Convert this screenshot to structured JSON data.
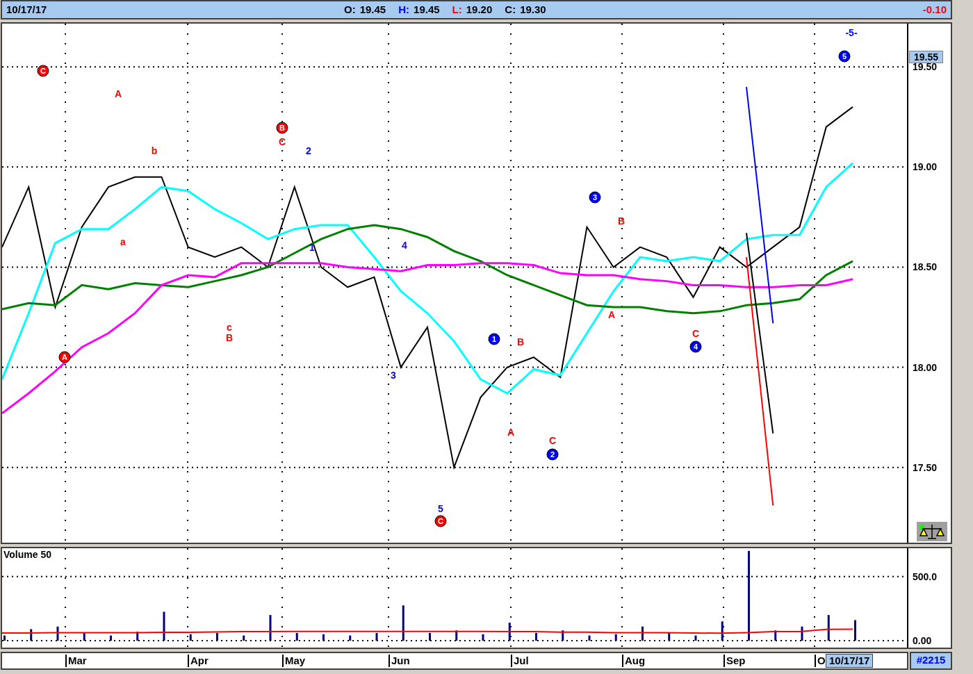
{
  "header": {
    "date": "10/17/17",
    "fields": [
      {
        "label": "O:",
        "value": "19.45"
      },
      {
        "label": "H:",
        "value": "19.45"
      },
      {
        "label": "L:",
        "value": "19.20"
      },
      {
        "label": "C:",
        "value": "19.30"
      }
    ],
    "change": "-0.10"
  },
  "price_pane": {
    "last_price": "19.55",
    "chart_data": {
      "type": "line",
      "categories": [
        null,
        null,
        null,
        null,
        null,
        null,
        null,
        null,
        null,
        null,
        null,
        null,
        null,
        null,
        null,
        null,
        null,
        null,
        null,
        null,
        null,
        null,
        null,
        null,
        null,
        null,
        null,
        null,
        null,
        null,
        null,
        null,
        null
      ],
      "series": [
        {
          "color": "#000000",
          "values": [
            18.6,
            18.9,
            18.3,
            18.7,
            18.9,
            18.95,
            18.95,
            18.6,
            18.55,
            18.6,
            18.5,
            18.9,
            18.5,
            18.4,
            18.45,
            18.0,
            18.2,
            17.5,
            17.85,
            18.0,
            18.05,
            17.95,
            18.7,
            18.5,
            18.6,
            18.55,
            18.35,
            18.6,
            18.5,
            18.6,
            18.7,
            19.2,
            19.3
          ]
        },
        {
          "color": "#00ffff",
          "values": [
            17.94,
            18.27,
            18.62,
            18.69,
            18.69,
            18.79,
            18.9,
            18.88,
            18.79,
            18.72,
            18.64,
            18.69,
            18.71,
            18.71,
            18.55,
            18.38,
            18.27,
            18.13,
            17.94,
            17.87,
            17.99,
            17.96,
            18.17,
            18.38,
            18.55,
            18.53,
            18.55,
            18.53,
            18.64,
            18.66,
            18.66,
            18.9,
            19.02
          ]
        },
        {
          "color": "#008000",
          "values": [
            18.29,
            18.32,
            18.31,
            18.41,
            18.39,
            18.42,
            18.41,
            18.4,
            18.43,
            18.46,
            18.5,
            18.57,
            18.64,
            18.69,
            18.71,
            18.69,
            18.65,
            18.58,
            18.53,
            18.46,
            18.41,
            18.36,
            18.31,
            18.3,
            18.3,
            18.28,
            18.27,
            18.28,
            18.31,
            18.32,
            18.34,
            18.46,
            18.53
          ]
        },
        {
          "color": "#ff00ff",
          "values": [
            17.77,
            17.87,
            17.98,
            18.1,
            18.17,
            18.27,
            18.41,
            18.46,
            18.45,
            18.52,
            18.52,
            18.52,
            18.52,
            18.5,
            18.49,
            18.48,
            18.51,
            18.51,
            18.52,
            18.52,
            18.51,
            18.47,
            18.46,
            18.46,
            18.44,
            18.43,
            18.41,
            18.41,
            18.4,
            18.4,
            18.41,
            18.41,
            18.44
          ]
        },
        {
          "color": "#ff0000",
          "values": [
            null,
            null,
            null,
            null,
            null,
            null,
            null,
            null,
            null,
            null,
            null,
            null,
            null,
            null,
            null,
            null,
            null,
            null,
            null,
            null,
            null,
            null,
            null,
            null,
            null,
            null,
            null,
            null,
            18.55,
            17.31,
            null,
            null,
            null
          ]
        },
        {
          "color": "#000000",
          "values": [
            null,
            null,
            null,
            null,
            null,
            null,
            null,
            null,
            null,
            null,
            null,
            null,
            null,
            null,
            null,
            null,
            null,
            null,
            null,
            null,
            null,
            null,
            null,
            null,
            null,
            null,
            null,
            null,
            18.67,
            17.67,
            null,
            null,
            null
          ]
        },
        {
          "color": "#0000ff",
          "values": [
            null,
            null,
            null,
            null,
            null,
            null,
            null,
            null,
            null,
            null,
            null,
            null,
            null,
            null,
            null,
            null,
            null,
            null,
            null,
            null,
            null,
            null,
            null,
            null,
            null,
            null,
            null,
            null,
            19.4,
            18.22,
            null,
            null,
            null
          ]
        }
      ],
      "ylim": [
        17.124,
        19.716
      ],
      "grid": true,
      "yticks": [
        {
          "value": 17.5,
          "label": "17.50"
        },
        {
          "value": 18,
          "label": "18.00"
        },
        {
          "value": 18.5,
          "label": "18.50"
        },
        {
          "value": 19,
          "label": "19.00"
        },
        {
          "value": 19.5,
          "label": "19.50"
        }
      ]
    },
    "wave_labels": [
      {
        "text": "C",
        "kind": "circle",
        "color": "#ff0000"
      },
      {
        "text": "A",
        "kind": "plain",
        "color": "#ff0000"
      },
      {
        "text": "b",
        "kind": "plain",
        "color": "#ff0000"
      },
      {
        "text": "a",
        "kind": "plain",
        "color": "#ff0000"
      },
      {
        "text": "A",
        "kind": "circle",
        "color": "#ff0000"
      },
      {
        "text": "c",
        "kind": "plain",
        "color": "#ff0000"
      },
      {
        "text": "B",
        "kind": "plain",
        "color": "#ff0000"
      },
      {
        "text": "B",
        "kind": "circle",
        "color": "#ff0000"
      },
      {
        "text": "C",
        "kind": "plain",
        "color": "#ff0000"
      },
      {
        "text": "1",
        "kind": "plain",
        "color": "#0000ff"
      },
      {
        "text": "2",
        "kind": "plain",
        "color": "#0000ff"
      },
      {
        "text": "3",
        "kind": "plain",
        "color": "#0000ff"
      },
      {
        "text": "4",
        "kind": "plain",
        "color": "#0000ff"
      },
      {
        "text": "5",
        "kind": "plain",
        "color": "#0000ff"
      },
      {
        "text": "C",
        "kind": "circle",
        "color": "#ff0000"
      },
      {
        "text": "1",
        "kind": "circle",
        "color": "#0000ff"
      },
      {
        "text": "A",
        "kind": "plain",
        "color": "#ff0000"
      },
      {
        "text": "B",
        "kind": "plain",
        "color": "#ff0000"
      },
      {
        "text": "C",
        "kind": "plain",
        "color": "#ff0000"
      },
      {
        "text": "2",
        "kind": "circle",
        "color": "#0000ff"
      },
      {
        "text": "3",
        "kind": "circle",
        "color": "#0000ff"
      },
      {
        "text": "A",
        "kind": "plain",
        "color": "#ff0000"
      },
      {
        "text": "B",
        "kind": "plain",
        "color": "#ff0000"
      },
      {
        "text": "C",
        "kind": "plain",
        "color": "#ff0000"
      },
      {
        "text": "4",
        "kind": "circle",
        "color": "#0000ff"
      },
      {
        "text": "5",
        "kind": "circle",
        "color": "#0000ff"
      },
      {
        "text": "-5-",
        "kind": "plain",
        "color": "#0000ff"
      }
    ]
  },
  "volume_pane": {
    "title": "Volume 50",
    "chart_data": {
      "type": "bar",
      "categories": [
        null,
        null,
        null,
        null,
        null,
        null,
        null,
        null,
        null,
        null,
        null,
        null,
        null,
        null,
        null,
        null,
        null,
        null,
        null,
        null,
        null,
        null,
        null,
        null,
        null,
        null,
        null,
        null,
        null,
        null,
        null,
        null,
        null
      ],
      "series": [
        {
          "color": "#000080",
          "values": [
            40,
            90,
            110,
            60,
            40,
            70,
            225,
            50,
            60,
            40,
            200,
            60,
            50,
            40,
            60,
            275,
            60,
            80,
            50,
            140,
            60,
            80,
            40,
            50,
            110,
            60,
            40,
            150,
            700,
            80,
            110,
            200,
            160
          ]
        },
        {
          "color": "#ff0000",
          "type": "line",
          "values": [
            60,
            60,
            62,
            62,
            62,
            62,
            65,
            65,
            68,
            70,
            70,
            72,
            72,
            72,
            72,
            72,
            72,
            72,
            72,
            70,
            70,
            66,
            66,
            62,
            62,
            62,
            60,
            58,
            62,
            70,
            70,
            88,
            90
          ]
        }
      ],
      "ylim": [
        0,
        710
      ],
      "yticks": [
        {
          "value": 0,
          "label": "0.00"
        },
        {
          "value": 500,
          "label": "500.0"
        }
      ]
    }
  },
  "time_axis": {
    "months": [
      "Mar",
      "Apr",
      "May",
      "Jun",
      "Jul",
      "Aug",
      "Sep",
      "O"
    ],
    "cursor_date": "10/17/17",
    "bar_count": "#2215"
  }
}
